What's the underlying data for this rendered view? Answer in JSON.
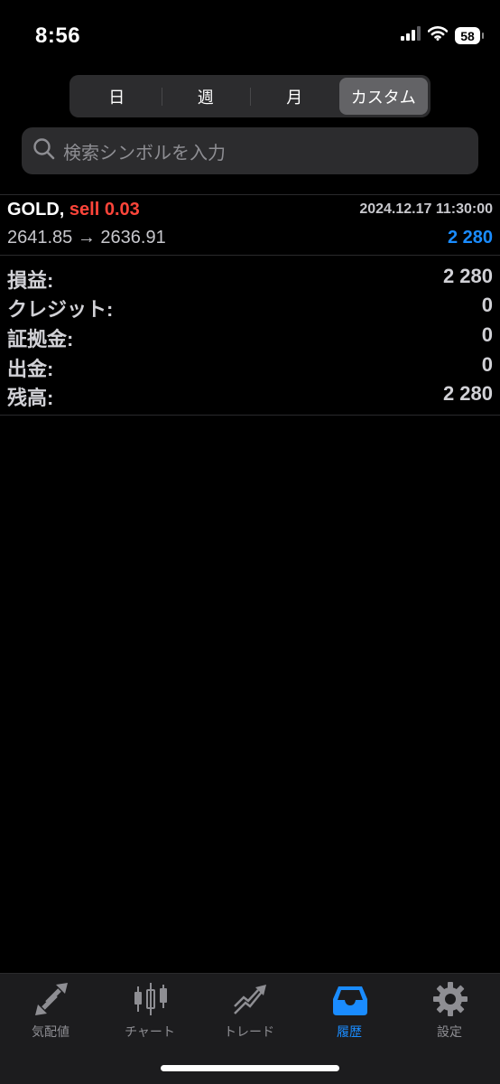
{
  "status": {
    "time": "8:56",
    "battery": "58"
  },
  "segments": [
    {
      "label": "日",
      "active": false
    },
    {
      "label": "週",
      "active": false
    },
    {
      "label": "月",
      "active": false
    },
    {
      "label": "カスタム",
      "active": true
    }
  ],
  "search": {
    "placeholder": "検索シンボルを入力"
  },
  "trade": {
    "symbol": "GOLD,",
    "side": "sell 0.03",
    "datetime": "2024.12.17 11:30:00",
    "prices": "2641.85 → 2636.91",
    "profit": "2 280"
  },
  "summary": [
    {
      "label": "損益:",
      "value": "2 280"
    },
    {
      "label": "クレジット:",
      "value": "0"
    },
    {
      "label": "証拠金:",
      "value": "0"
    },
    {
      "label": "出金:",
      "value": "0"
    },
    {
      "label": "残高:",
      "value": "2 280"
    }
  ],
  "tabs": [
    {
      "label": "気配値",
      "icon": "quotes-arrows-icon",
      "active": false
    },
    {
      "label": "チャート",
      "icon": "candlestick-icon",
      "active": false
    },
    {
      "label": "トレード",
      "icon": "trade-trend-icon",
      "active": false
    },
    {
      "label": "履歴",
      "icon": "inbox-tray-icon",
      "active": true
    },
    {
      "label": "設定",
      "icon": "gear-icon",
      "active": false
    }
  ],
  "colors": {
    "sell": "#ff453a",
    "accent": "#1a8cff",
    "background": "#000000"
  }
}
